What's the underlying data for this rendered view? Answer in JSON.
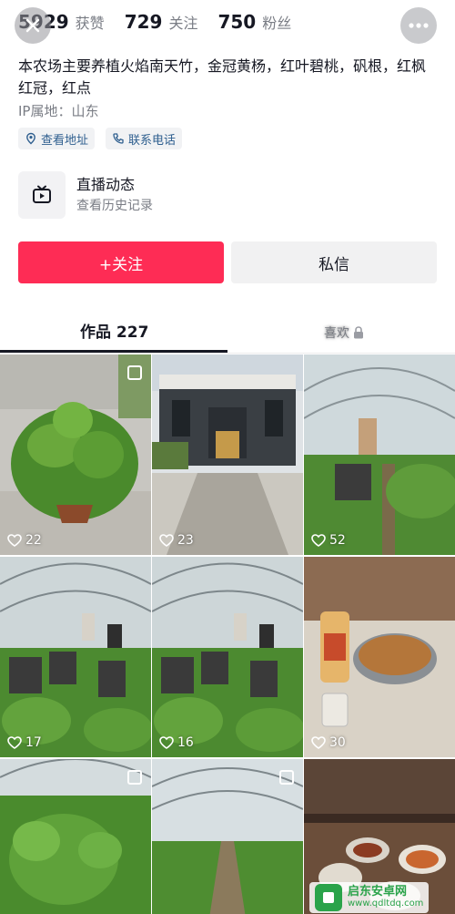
{
  "stats": [
    {
      "num": "5929",
      "label": "获赞"
    },
    {
      "num": "729",
      "label": "关注"
    },
    {
      "num": "750",
      "label": "粉丝"
    }
  ],
  "bio": "本农场主要养植火焰南天竹，金冠黄杨，红叶碧桃，矾根，红枫红冠，红点",
  "ip_location": "IP属地：山东",
  "tags": {
    "address": "查看地址",
    "phone": "联系电话"
  },
  "live": {
    "title": "直播动态",
    "subtitle": "查看历史记录"
  },
  "buttons": {
    "follow": "+关注",
    "message": "私信"
  },
  "tabs": {
    "works": "作品 227",
    "likes": "喜欢"
  },
  "videos": [
    {
      "likes": "22",
      "multi": true
    },
    {
      "likes": "23",
      "multi": false
    },
    {
      "likes": "52",
      "multi": false
    },
    {
      "likes": "17",
      "multi": false
    },
    {
      "likes": "16",
      "multi": false
    },
    {
      "likes": "30",
      "multi": false
    },
    {
      "likes": "",
      "multi": true
    },
    {
      "likes": "",
      "multi": true
    },
    {
      "likes": "",
      "multi": false
    }
  ],
  "watermark": {
    "name": "启东安卓网",
    "url": "www.qdltdq.com"
  },
  "colors": {
    "accent": "#fe2c55",
    "tag_text": "#2f5f8f",
    "muted": "#7a7d85"
  }
}
